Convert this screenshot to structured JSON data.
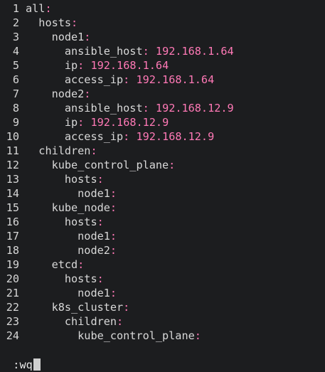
{
  "editor": {
    "lines": [
      {
        "n": "1",
        "indent": "",
        "key": "all",
        "value": ""
      },
      {
        "n": "2",
        "indent": "  ",
        "key": "hosts",
        "value": ""
      },
      {
        "n": "3",
        "indent": "    ",
        "key": "node1",
        "value": ""
      },
      {
        "n": "4",
        "indent": "      ",
        "key": "ansible_host",
        "value": "192.168.1.64"
      },
      {
        "n": "5",
        "indent": "      ",
        "key": "ip",
        "value": "192.168.1.64"
      },
      {
        "n": "6",
        "indent": "      ",
        "key": "access_ip",
        "value": "192.168.1.64"
      },
      {
        "n": "7",
        "indent": "    ",
        "key": "node2",
        "value": ""
      },
      {
        "n": "8",
        "indent": "      ",
        "key": "ansible_host",
        "value": "192.168.12.9"
      },
      {
        "n": "9",
        "indent": "      ",
        "key": "ip",
        "value": "192.168.12.9"
      },
      {
        "n": "10",
        "indent": "      ",
        "key": "access_ip",
        "value": "192.168.12.9"
      },
      {
        "n": "11",
        "indent": "  ",
        "key": "children",
        "value": ""
      },
      {
        "n": "12",
        "indent": "    ",
        "key": "kube_control_plane",
        "value": ""
      },
      {
        "n": "13",
        "indent": "      ",
        "key": "hosts",
        "value": ""
      },
      {
        "n": "14",
        "indent": "        ",
        "key": "node1",
        "value": ""
      },
      {
        "n": "15",
        "indent": "    ",
        "key": "kube_node",
        "value": ""
      },
      {
        "n": "16",
        "indent": "      ",
        "key": "hosts",
        "value": ""
      },
      {
        "n": "17",
        "indent": "        ",
        "key": "node1",
        "value": ""
      },
      {
        "n": "18",
        "indent": "        ",
        "key": "node2",
        "value": ""
      },
      {
        "n": "19",
        "indent": "    ",
        "key": "etcd",
        "value": ""
      },
      {
        "n": "20",
        "indent": "      ",
        "key": "hosts",
        "value": ""
      },
      {
        "n": "21",
        "indent": "        ",
        "key": "node1",
        "value": ""
      },
      {
        "n": "22",
        "indent": "    ",
        "key": "k8s_cluster",
        "value": ""
      },
      {
        "n": "23",
        "indent": "      ",
        "key": "children",
        "value": ""
      },
      {
        "n": "24",
        "indent": "        ",
        "key": "kube_control_plane",
        "value": ""
      }
    ]
  },
  "command_line": {
    "text": ":wq"
  },
  "colors": {
    "background": "#1c1d1f",
    "line_number": "#d6d6d6",
    "key": "#d8d8d8",
    "colon_and_value": "#ff79b6"
  }
}
